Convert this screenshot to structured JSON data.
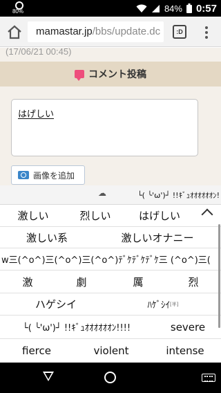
{
  "status_bar": {
    "battery_circle_pct": "80%",
    "battery_pct": "84%",
    "time": "0:57"
  },
  "browser": {
    "url_host": "mamastar.jp",
    "url_path": "/bbs/update.dc",
    "tabs_label": ":D"
  },
  "page": {
    "date": "(17/06/21 00:45)",
    "section_title": "コメント投稿",
    "comment_text": "はげしい",
    "add_image_label": "画像を追加"
  },
  "keyboard": {
    "top_preview": "└( ╰'ω')┘ !!ｷﾞｭｵｵｵｵｵｵﾝ!",
    "rows": [
      [
        "激しい",
        "烈しい",
        "はげしい"
      ],
      [
        "激しい系",
        "激しいオナニー"
      ],
      [
        "w三(^o^)三(^o^)三(^o^)ﾃﾞｹﾃﾞｹﾃﾞｹ三 (^o^)三("
      ],
      [
        "激",
        "劇",
        "厲",
        "烈"
      ],
      [
        "ハゲシイ",
        "ﾊｹﾞｼｲ"
      ],
      [
        "└( ╰'ω')┘ !!ｷﾞｭｵｵｵｵｵｵﾝ!!!!",
        "severe"
      ],
      [
        "fierce",
        "violent",
        "intense"
      ]
    ],
    "half_width_mark": "[半]"
  },
  "icons": {
    "status_left": "battery-circle-icon",
    "wifi": "wifi-icon",
    "signal": "signal-icon",
    "battery": "battery-icon",
    "home": "home-icon",
    "tabs": "tab-switcher-icon",
    "menu": "overflow-menu-icon",
    "comment": "comment-icon",
    "camera": "camera-icon",
    "cloud": "cloud-icon",
    "collapse": "chevron-up-icon",
    "back": "back-icon",
    "nav_home": "home-circle-icon",
    "keyboard": "keyboard-icon"
  },
  "colors": {
    "status_bar": "#000000",
    "section_header": "#e4d8c4",
    "page_bg": "#f4f0ea",
    "comment_icon": "#ee4e7c",
    "camera_icon": "#3b86c9"
  }
}
